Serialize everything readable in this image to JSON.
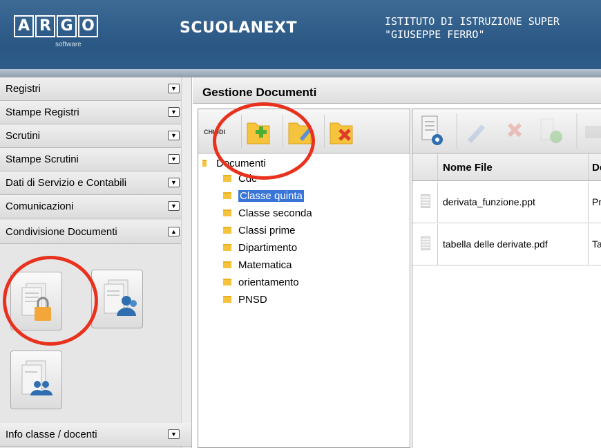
{
  "header": {
    "logo_letters": [
      "A",
      "R",
      "G",
      "O"
    ],
    "logo_sub": "software",
    "app_name": "SCUOLANEXT",
    "school_line1": "ISTITUTO DI ISTRUZIONE SUPER",
    "school_line2": "\"GIUSEPPE FERRO\""
  },
  "sidebar": {
    "items": [
      {
        "label": "Registri",
        "toggle": "▼"
      },
      {
        "label": "Stampe Registri",
        "toggle": "▼"
      },
      {
        "label": "Scrutini",
        "toggle": "▼"
      },
      {
        "label": "Stampe Scrutini",
        "toggle": "▼"
      },
      {
        "label": "Dati di Servizio e Contabili",
        "toggle": "▼"
      },
      {
        "label": "Comunicazioni",
        "toggle": "▼"
      },
      {
        "label": "Condivisione Documenti",
        "toggle": "▲"
      }
    ],
    "bottom_item": {
      "label": "Info classe / docenti",
      "toggle": "▼"
    }
  },
  "main": {
    "title": "Gestione Documenti",
    "tree_toolbar": {
      "close_label": "CHIUDI"
    },
    "tree": {
      "root": "Documenti",
      "children": [
        "Cdc",
        "Classe quinta",
        "Classe seconda",
        "Classi prime",
        "Dipartimento",
        "Matematica",
        "orientamento",
        "PNSD"
      ],
      "selected_index": 1
    },
    "grid": {
      "columns": [
        "Nome File",
        "De"
      ],
      "rows": [
        {
          "name": "derivata_funzione.ppt",
          "desc": "Pr"
        },
        {
          "name": "tabella delle derivate.pdf",
          "desc": "Ta"
        }
      ]
    }
  },
  "colors": {
    "accent_red": "#e8321e",
    "selection": "#3875d7",
    "header_blue": "#2a5783",
    "folder": "#f5c43c"
  }
}
